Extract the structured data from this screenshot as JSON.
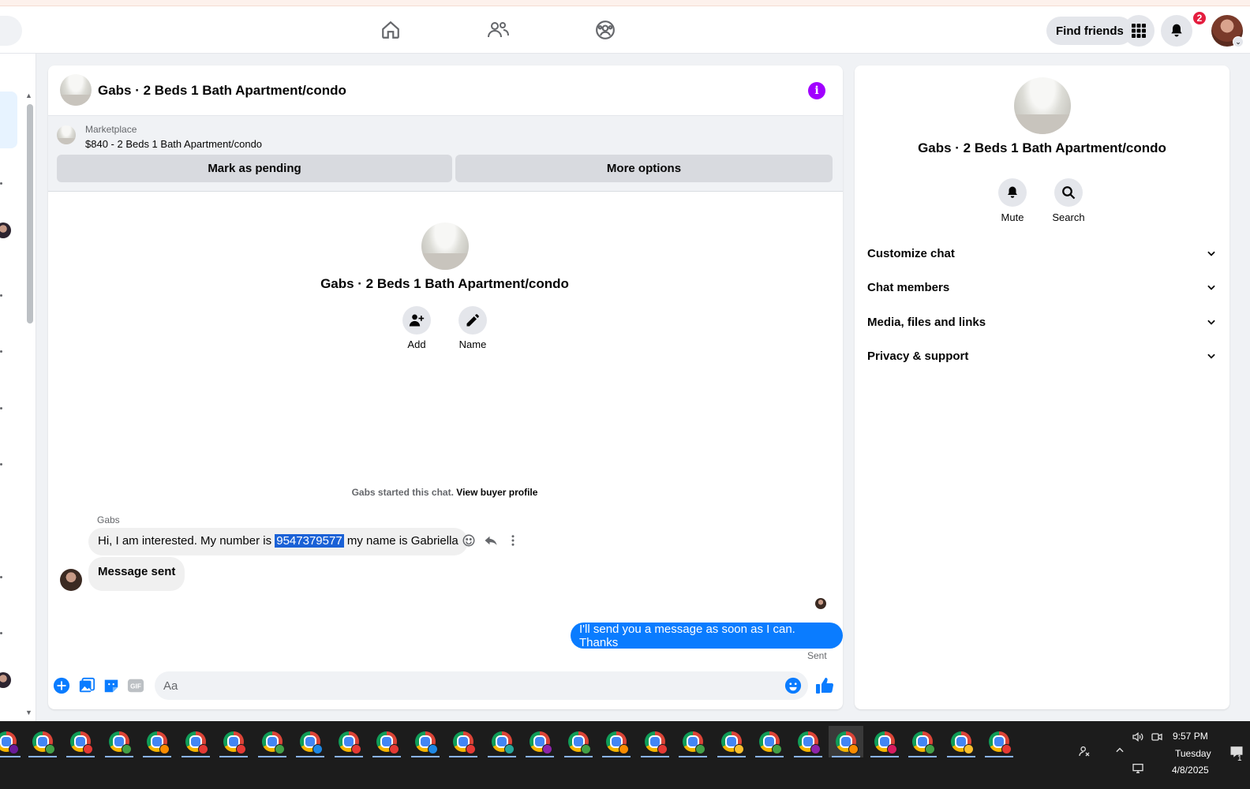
{
  "topnav": {
    "find_friends": "Find friends",
    "notification_count": "2"
  },
  "chat": {
    "title": "Gabs · 2 Beds 1 Bath Apartment/condo",
    "marketplace_label": "Marketplace",
    "listing": "$840 - 2 Beds 1 Bath Apartment/condo",
    "mark_pending": "Mark as pending",
    "more_options": "More options",
    "intro_title": "Gabs · 2 Beds 1 Bath Apartment/condo",
    "add_label": "Add",
    "name_label": "Name",
    "started_text": "Gabs started this chat.",
    "view_buyer": "View buyer profile",
    "sender_name": "Gabs",
    "msg1_before": "Hi, I am interested. My number is",
    "msg1_highlight": "9547379577",
    "msg1_after": "my name is Gabriella",
    "msg2": "Message sent",
    "outgoing": "I'll send you a message as soon as I can. Thanks",
    "sent_status": "Sent",
    "composer_placeholder": "Aa"
  },
  "info": {
    "title": "Gabs · 2 Beds 1 Bath Apartment/condo",
    "mute": "Mute",
    "search": "Search",
    "sections": [
      "Customize chat",
      "Chat members",
      "Media, files and links",
      "Privacy & support"
    ]
  },
  "taskbar": {
    "time": "9:57 PM",
    "day": "Tuesday",
    "date": "4/8/2025",
    "notification_count": "1"
  },
  "colors": {
    "accent": "#0a7cff",
    "highlight": "#1a61d6",
    "info_icon": "#a100ff",
    "badge": "#e41e3f"
  }
}
